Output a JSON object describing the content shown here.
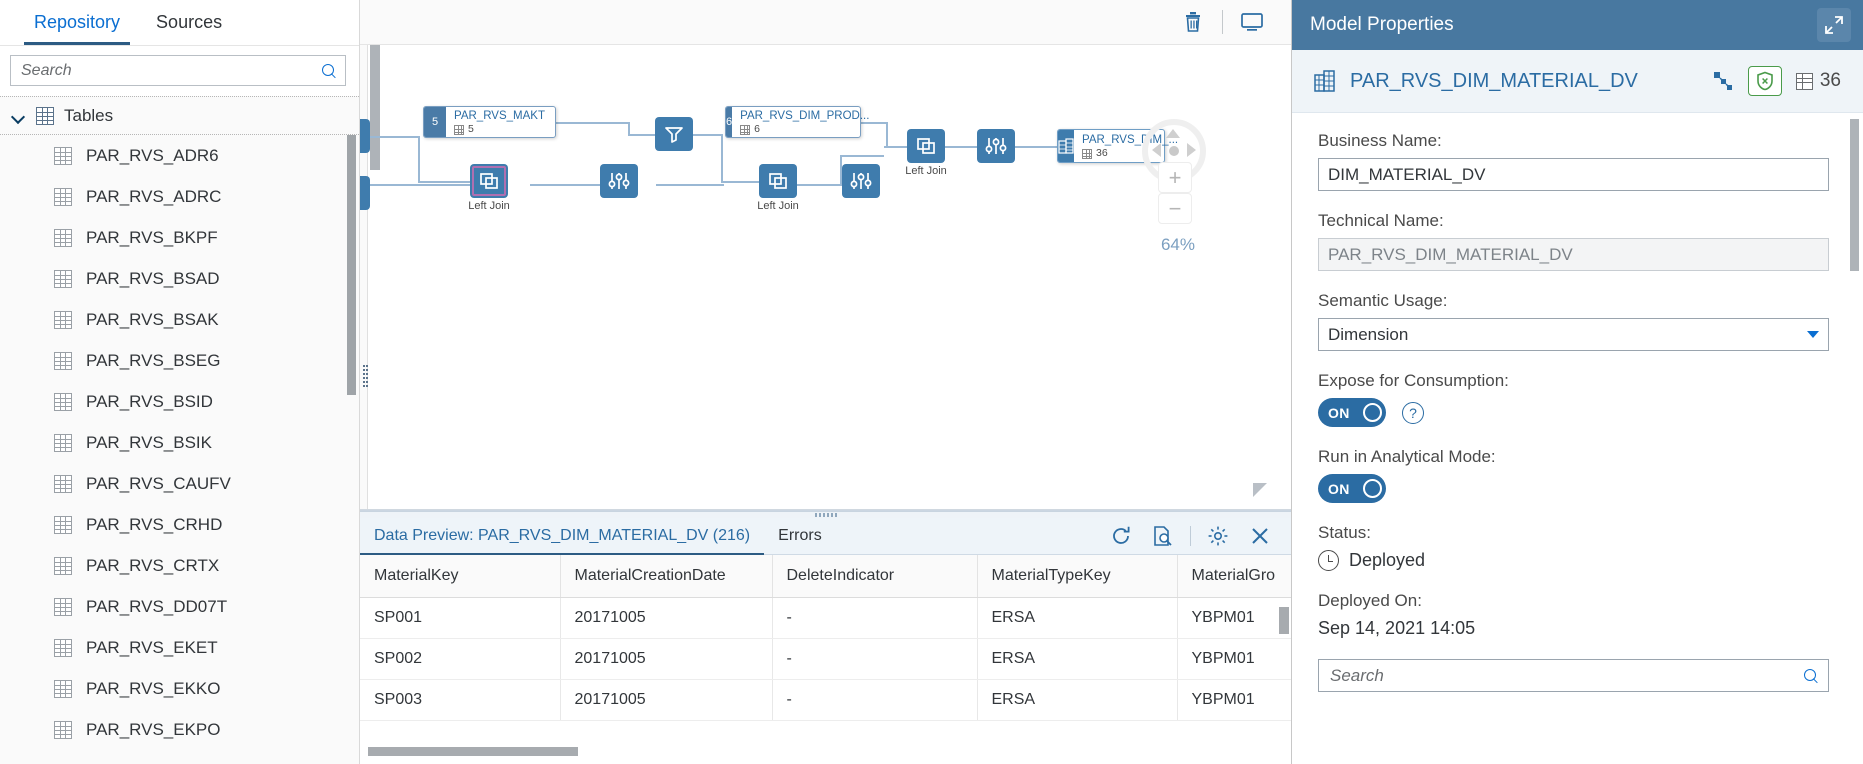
{
  "sidebar": {
    "tabs": [
      {
        "label": "Repository",
        "active": true
      },
      {
        "label": "Sources",
        "active": false
      }
    ],
    "search_placeholder": "Search",
    "search_value": "",
    "tree_root_label": "Tables",
    "tables": [
      "PAR_RVS_ADR6",
      "PAR_RVS_ADRC",
      "PAR_RVS_BKPF",
      "PAR_RVS_BSAD",
      "PAR_RVS_BSAK",
      "PAR_RVS_BSEG",
      "PAR_RVS_BSID",
      "PAR_RVS_BSIK",
      "PAR_RVS_CAUFV",
      "PAR_RVS_CRHD",
      "PAR_RVS_CRTX",
      "PAR_RVS_DD07T",
      "PAR_RVS_EKET",
      "PAR_RVS_EKKO",
      "PAR_RVS_EKPO"
    ]
  },
  "canvas": {
    "toolbar": [
      {
        "name": "delete-icon",
        "label": "Delete"
      },
      {
        "name": "preview-icon",
        "label": "Preview"
      }
    ],
    "zoom_level": "64%",
    "nodes": [
      {
        "id": "makt",
        "index": "5",
        "name": "PAR_RVS_MAKT",
        "count": "5",
        "type": "table"
      },
      {
        "id": "dim_prod",
        "index": "6",
        "name": "PAR_RVS_DIM_PROD...",
        "count": "6",
        "type": "table"
      },
      {
        "id": "dim_material",
        "index": "",
        "name": "PAR_RVS_DIM_...",
        "count": "36",
        "type": "output"
      }
    ],
    "operators": [
      {
        "id": "filter1",
        "icon": "filter-icon",
        "label": ""
      },
      {
        "id": "join1",
        "icon": "join-icon",
        "label": "Left Join"
      },
      {
        "id": "join2",
        "icon": "join-icon",
        "label": "Left Join"
      },
      {
        "id": "proj1",
        "icon": "projection-icon",
        "label": ""
      },
      {
        "id": "proj2",
        "icon": "projection-icon",
        "label": ""
      },
      {
        "id": "proj3",
        "icon": "projection-icon",
        "label": ""
      }
    ]
  },
  "data_preview": {
    "tabs": [
      {
        "label": "Data Preview: PAR_RVS_DIM_MATERIAL_DV (216)",
        "active": true
      },
      {
        "label": "Errors",
        "active": false
      }
    ],
    "actions": [
      {
        "name": "refresh-icon"
      },
      {
        "name": "preview-doc-icon"
      },
      {
        "name": "settings-gear-icon"
      },
      {
        "name": "close-icon"
      }
    ],
    "columns": [
      "MaterialKey",
      "MaterialCreationDate",
      "DeleteIndicator",
      "MaterialTypeKey",
      "MaterialGro"
    ],
    "rows": [
      [
        "SP001",
        "20171005",
        "-",
        "ERSA",
        "YBPM01"
      ],
      [
        "SP002",
        "20171005",
        "-",
        "ERSA",
        "YBPM01"
      ],
      [
        "SP003",
        "20171005",
        "-",
        "ERSA",
        "YBPM01"
      ]
    ]
  },
  "model_properties": {
    "panel_title": "Model Properties",
    "expand_icon": "expand-icon",
    "object_name": "PAR_RVS_DIM_MATERIAL_DV",
    "object_icon": "calculation-view-icon",
    "lineage_icon": "lineage-icon",
    "privilege_icon": "shield-check-icon",
    "column_count_icon": "grid-icon",
    "column_count": "36",
    "business_name_label": "Business Name:",
    "business_name_value": "DIM_MATERIAL_DV",
    "technical_name_label": "Technical Name:",
    "technical_name_value": "PAR_RVS_DIM_MATERIAL_DV",
    "semantic_usage_label": "Semantic Usage:",
    "semantic_usage_value": "Dimension",
    "expose_label": "Expose for Consumption:",
    "expose_toggle": "ON",
    "analytical_label": "Run in Analytical Mode:",
    "analytical_toggle": "ON",
    "status_label": "Status:",
    "status_value": "Deployed",
    "deployed_on_label": "Deployed On:",
    "deployed_on_value": "Sep 14, 2021 14:05",
    "search_placeholder": "Search",
    "search_value": "",
    "accent_color": "#4878a0",
    "toggle_on_color": "#2b6ca3",
    "link_color": "#2b6ca3"
  }
}
